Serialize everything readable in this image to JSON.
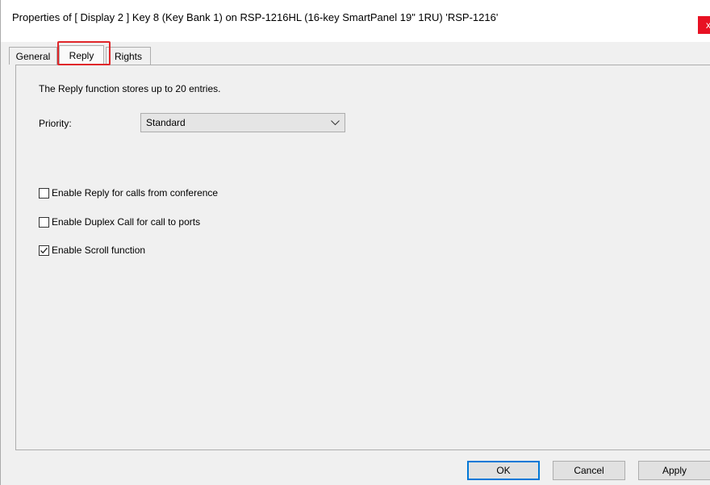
{
  "window": {
    "title": "Properties of [ Display 2 ] Key 8 (Key Bank 1) on RSP-1216HL (16-key SmartPanel 19\" 1RU) 'RSP-1216'",
    "close_label": "x"
  },
  "tabs": [
    {
      "label": "General",
      "active": false
    },
    {
      "label": "Reply",
      "active": true
    },
    {
      "label": "Rights",
      "active": false
    }
  ],
  "reply": {
    "info": "The Reply function stores up to 20 entries.",
    "priority_label": "Priority:",
    "priority_value": "Standard",
    "checkboxes": [
      {
        "label": "Enable Reply for calls from conference",
        "checked": false
      },
      {
        "label": "Enable Duplex Call for call to ports",
        "checked": false
      },
      {
        "label": "Enable Scroll function",
        "checked": true
      }
    ]
  },
  "buttons": {
    "ok": "OK",
    "cancel": "Cancel",
    "apply": "Apply"
  },
  "colors": {
    "highlight": "#e0262a",
    "close": "#e81123",
    "default_button_border": "#0078d7"
  }
}
